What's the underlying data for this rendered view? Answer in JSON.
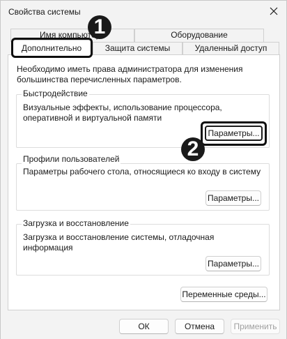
{
  "window": {
    "title": "Свойства системы"
  },
  "icons": {
    "close": "close-icon"
  },
  "tabs": {
    "row_top": [
      "Имя компьютера",
      "Оборудование"
    ],
    "row_bottom": [
      "Дополнительно",
      "Защита системы",
      "Удаленный доступ"
    ],
    "selected": "Дополнительно"
  },
  "notice": "Необходимо иметь права администратора для изменения большинства перечисленных параметров.",
  "performance": {
    "title": "Быстродействие",
    "description": "Визуальные эффекты, использование процессора, оперативной и виртуальной памяти",
    "button": "Параметры..."
  },
  "profiles": {
    "title": "Профили пользователей",
    "description": "Параметры рабочего стола, относящиеся ко входу в систему",
    "button": "Параметры..."
  },
  "startup": {
    "title": "Загрузка и восстановление",
    "description": "Загрузка и восстановление системы, отладочная информация",
    "button": "Параметры..."
  },
  "env_button": "Переменные среды...",
  "footer": {
    "ok": "ОК",
    "cancel": "Отмена",
    "apply": "Применить"
  },
  "callouts": {
    "first": "1",
    "second": "2"
  }
}
